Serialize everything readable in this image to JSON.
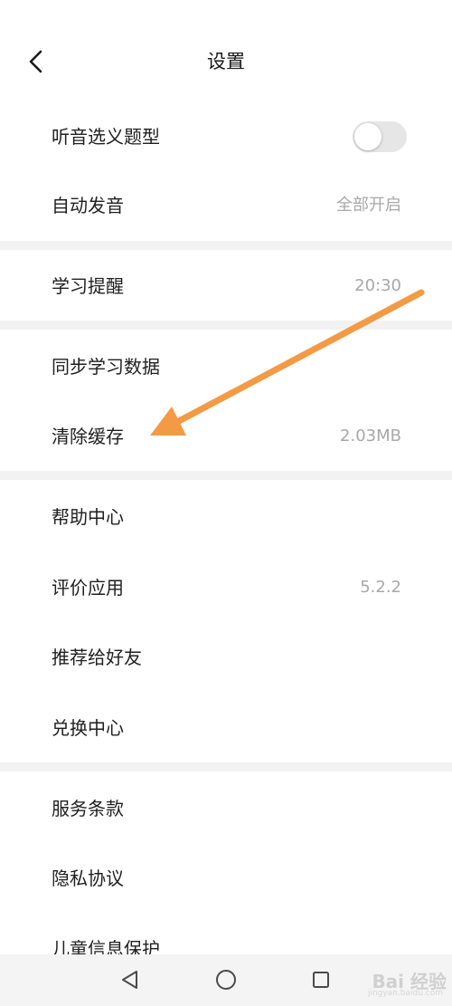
{
  "header": {
    "title": "设置",
    "back_icon": "chevron-left-icon"
  },
  "settings": {
    "group1": [
      {
        "label": "听音选义题型",
        "control": "toggle",
        "toggle_on": false
      },
      {
        "label": "自动发音",
        "value": "全部开启"
      }
    ],
    "group2": [
      {
        "label": "学习提醒",
        "value": "20:30"
      }
    ],
    "group3": [
      {
        "label": "同步学习数据"
      },
      {
        "label": "清除缓存",
        "value": "2.03MB"
      }
    ],
    "group4": [
      {
        "label": "帮助中心"
      },
      {
        "label": "评价应用",
        "value": "5.2.2"
      },
      {
        "label": "推荐给好友"
      },
      {
        "label": "兑换中心"
      }
    ],
    "group5": [
      {
        "label": "服务条款"
      },
      {
        "label": "隐私协议"
      },
      {
        "label": "儿童信息保护"
      }
    ]
  },
  "navbar": {
    "back_icon": "triangle-back-icon",
    "home_icon": "circle-home-icon",
    "recents_icon": "square-recents-icon"
  },
  "watermark": {
    "text": "Bai 经验",
    "sub": "jingyan.baidu.com"
  },
  "colors": {
    "background": "#ffffff",
    "divider": "#f2f2f2",
    "text_primary": "#1f1f1f",
    "text_secondary": "#a8a8a8",
    "toggle_off": "#e6e6e6",
    "annotation_arrow": "#f39a45"
  }
}
